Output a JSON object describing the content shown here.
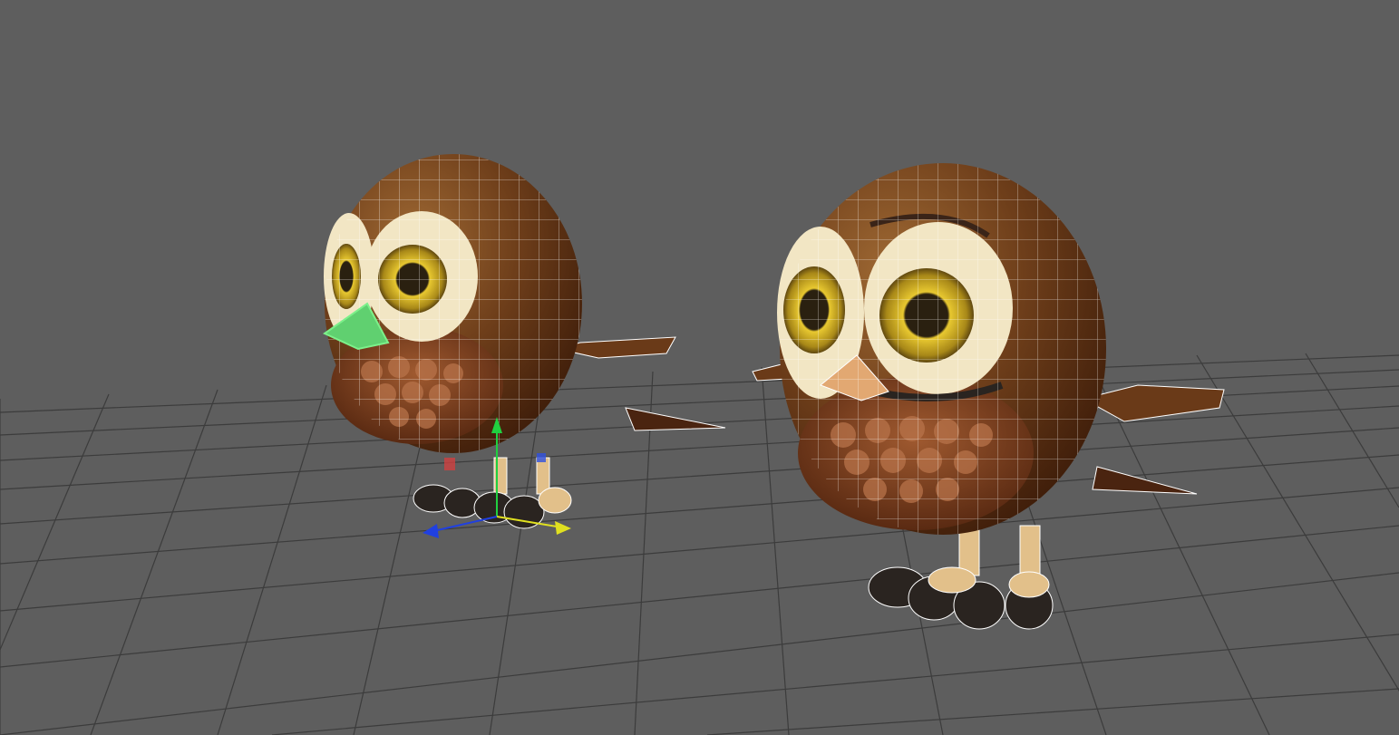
{
  "viewport": {
    "background": "#5e5e5e",
    "grid_color": "#3f3f3f",
    "wire_color": "#ffffff",
    "selection_color": "#7cf08a"
  },
  "objects": [
    {
      "name": "owl-selected",
      "selected": true
    },
    {
      "name": "owl-unselected",
      "selected": false
    }
  ],
  "gizmo": {
    "x_color": "#e0e020",
    "y_color": "#20d040",
    "z_color": "#2040e0",
    "center_color": "#d04040"
  },
  "palette": {
    "body_dark": "#4a240f",
    "body_mid": "#7a4a22",
    "body_light": "#9a6230",
    "eye_patch": "#f2e6c4",
    "iris": "#c8a820",
    "pupil": "#1a1208",
    "belly": "#7a3c1c",
    "belly_spot": "#b8734a",
    "feet": "#e2c08a",
    "claw": "#2a2420"
  }
}
